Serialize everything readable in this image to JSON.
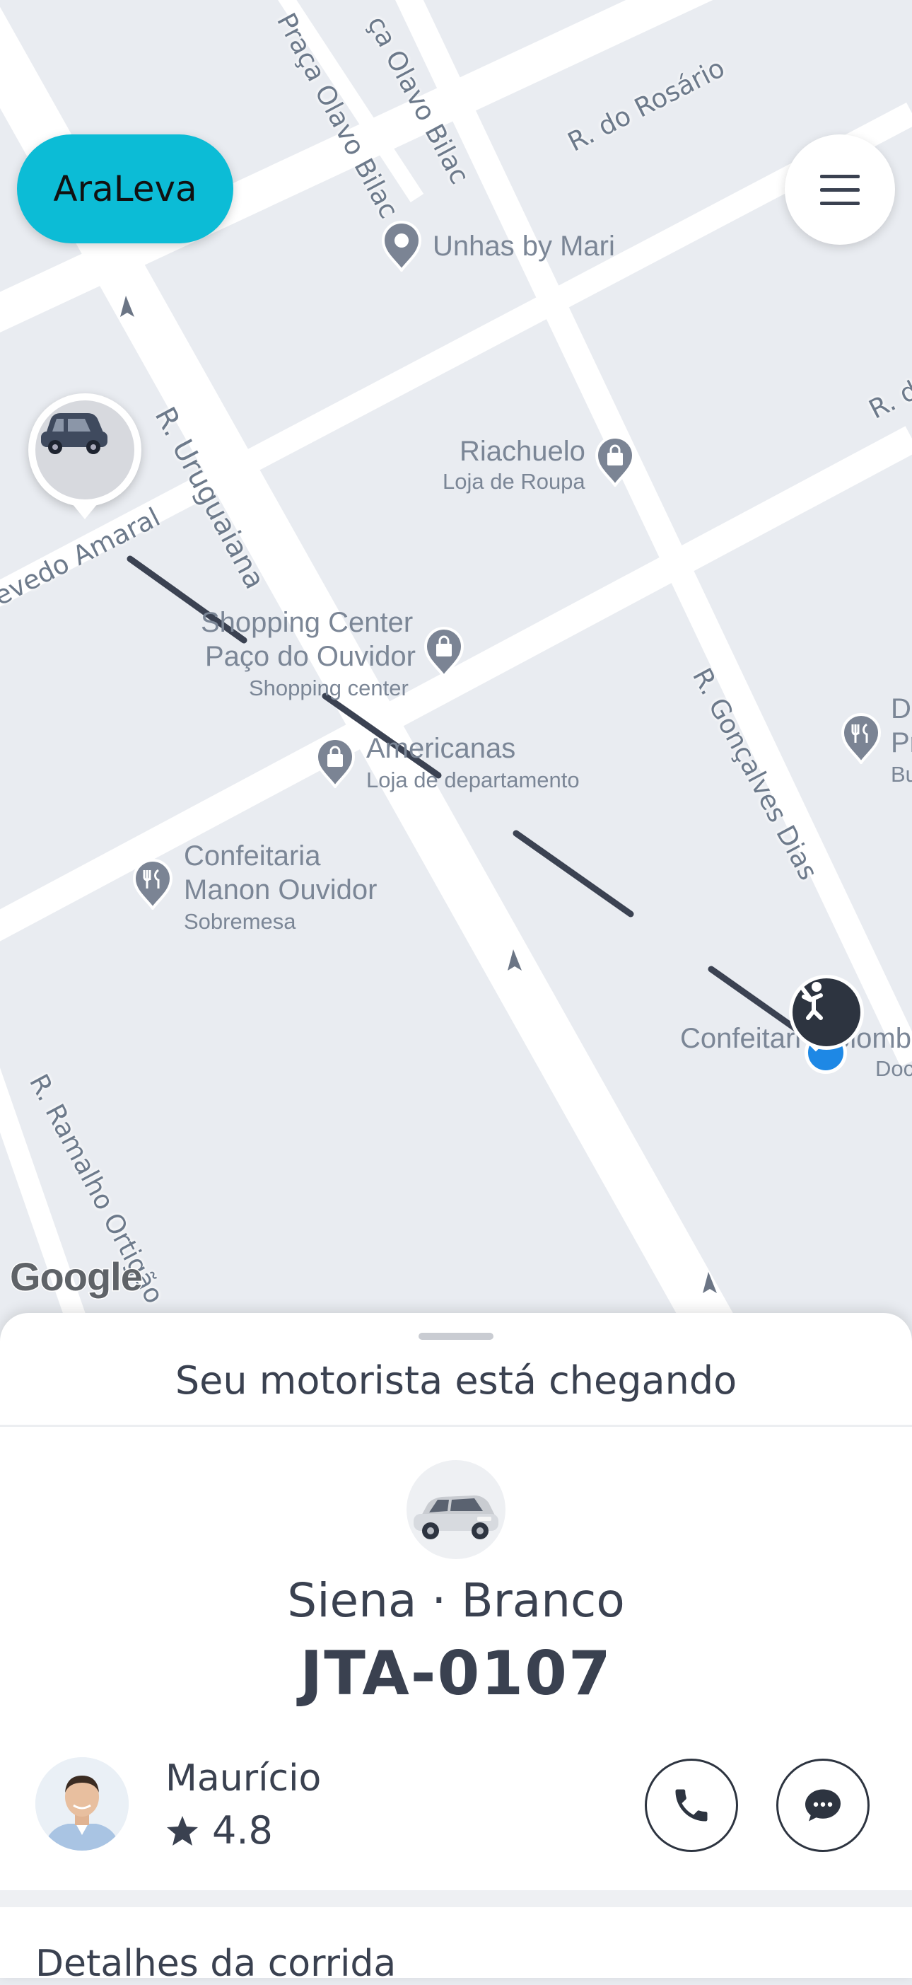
{
  "app": {
    "brand": "AraLeva"
  },
  "map": {
    "streets": [
      "R. do Rosário",
      "Praça Olavo Bilac",
      "ça Olavo Bilac",
      "R. Uruguaiana",
      "evedo Amaral",
      "R. Gonçalves Dias",
      "R. Ramalho Ortigão",
      "R. d"
    ],
    "pois": [
      {
        "name": "Unhas by Mari",
        "subtitle": ""
      },
      {
        "name": "Riachuelo",
        "subtitle": "Loja de Roupa"
      },
      {
        "name": "Shopping Center\nPaço do Ouvidor",
        "name_line1": "Shopping Center",
        "name_line2": "Paço do Ouvidor",
        "subtitle": "Shopping center"
      },
      {
        "name": "Americanas",
        "subtitle": "Loja de departamento"
      },
      {
        "name_line1": "Confeitaria",
        "name_line2": "Manon Ouvidor",
        "subtitle": "Sobremesa"
      },
      {
        "name": "Confeitaria Colombo",
        "visible_text": "Confeitari",
        "visible_text2": "olomb",
        "subtitle": "Doc"
      },
      {
        "name_line1": "D",
        "name_line2": "Pr",
        "subtitle": "Bu"
      }
    ],
    "attribution": "Google",
    "colors": {
      "route": "#3b4252",
      "pickup": "#1e88e5",
      "brand": "#0cbcd6"
    }
  },
  "sheet": {
    "title": "Seu motorista está chegando",
    "vehicle": "Siena · Branco",
    "plate": "JTA-0107",
    "driver": {
      "name": "Maurício",
      "rating": "4.8"
    },
    "actions": {
      "call_icon": "phone-icon",
      "chat_icon": "chat-icon"
    },
    "details_title": "Detalhes da corrida"
  }
}
